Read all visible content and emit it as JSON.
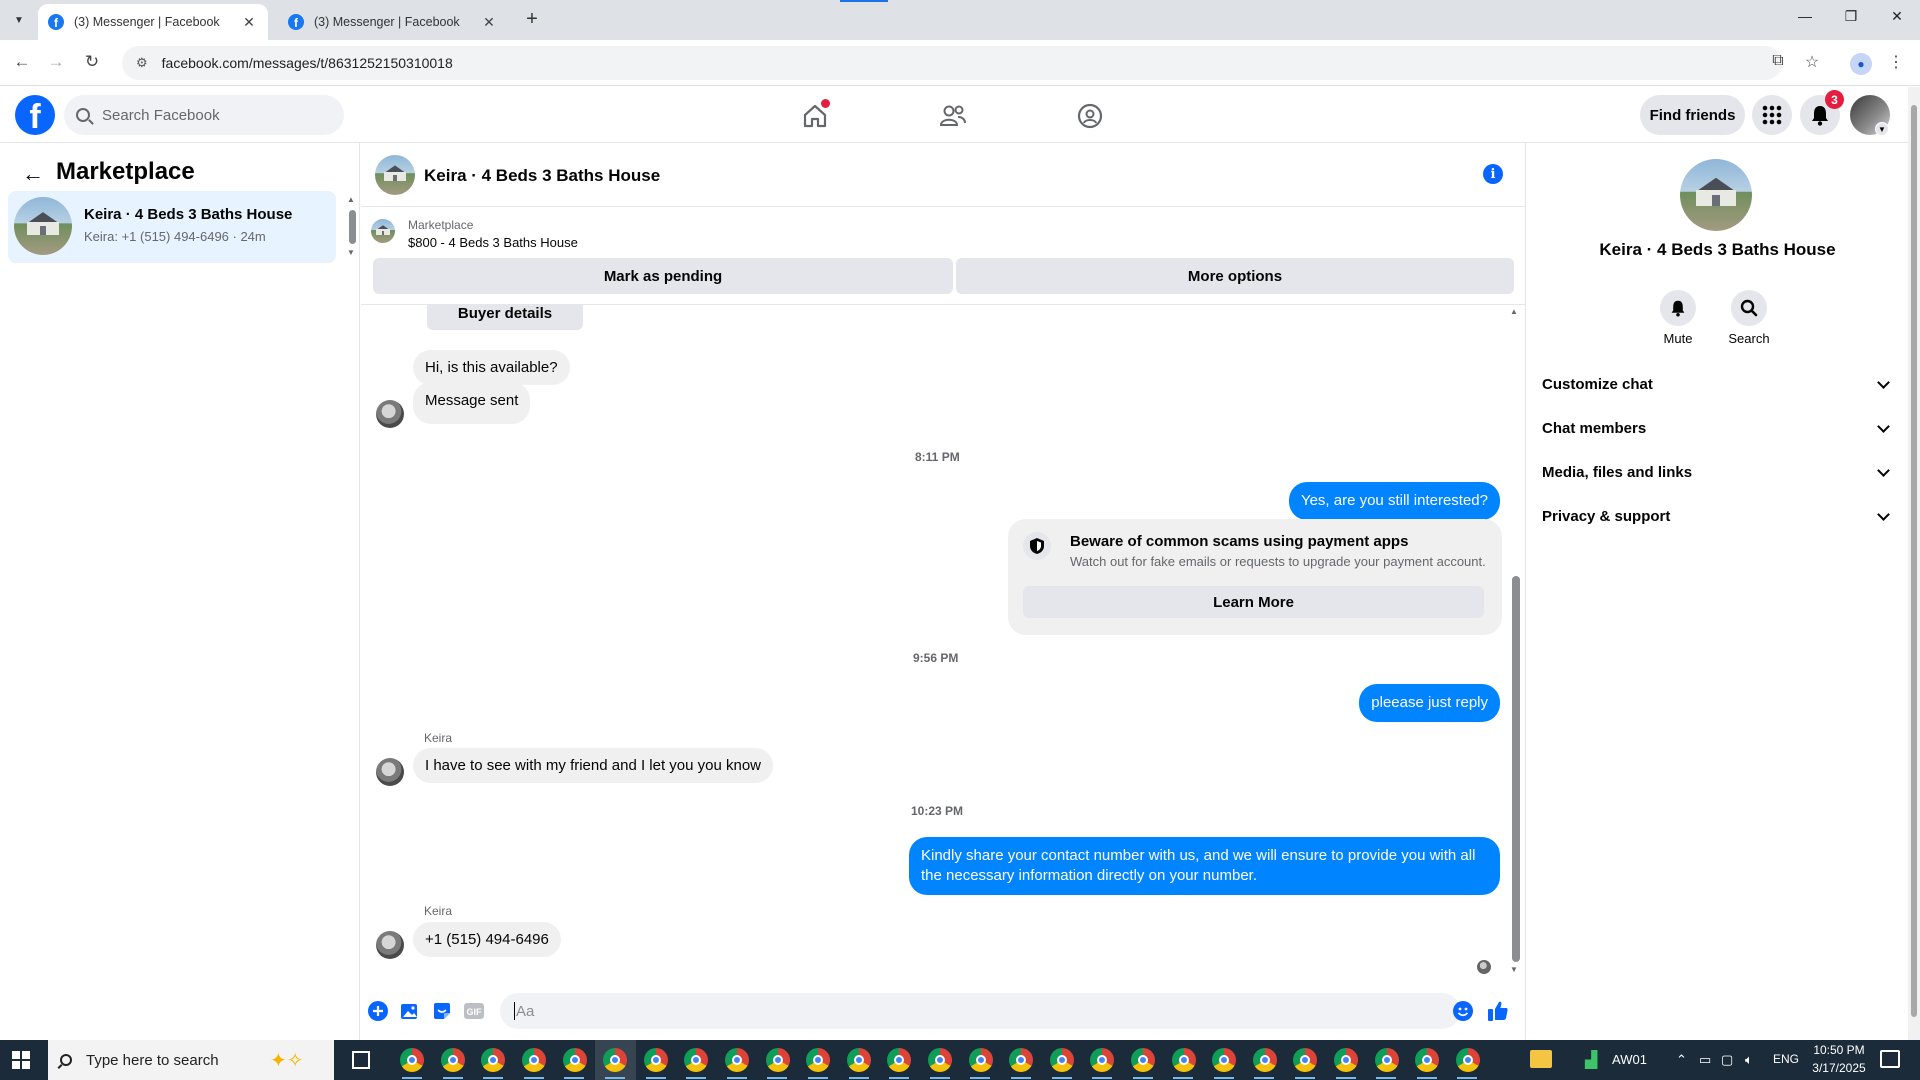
{
  "browser": {
    "tabs": [
      {
        "title": "(3) Messenger | Facebook",
        "active": true
      },
      {
        "title": "(3) Messenger | Facebook",
        "active": false
      }
    ],
    "url": "facebook.com/messages/t/8631252150310018"
  },
  "fb_nav": {
    "search_placeholder": "Search Facebook",
    "find_friends": "Find friends",
    "notifications_count": "3",
    "accent": "#0866ff"
  },
  "left_panel": {
    "title": "Marketplace",
    "thread": {
      "name": "Keira · 4 Beds 3 Baths House",
      "preview": "Keira: +1 (515) 494-6496 · 24m"
    }
  },
  "chat": {
    "title": "Keira · 4 Beds 3 Baths House",
    "marketplace_label": "Marketplace",
    "listing": "$800 - 4 Beds 3 Baths House",
    "mark_pending": "Mark as pending",
    "more_options": "More options",
    "buyer_details": "Buyer details",
    "messages": {
      "m1": "Hi, is this available?",
      "m2": "Message sent",
      "ts1": "8:11 PM",
      "m3": "Yes, are you still interested?",
      "scam_title": "Beware of common scams using payment apps",
      "scam_body": "Watch out for fake emails or requests to upgrade your payment account.",
      "learn_more": "Learn More",
      "ts2": "9:56 PM",
      "m4": "pleease just reply",
      "sender1": "Keira",
      "m5": "I have to see with my friend and I let you you know",
      "ts3": "10:23 PM",
      "m6": "Kindly share your contact number with us, and we will ensure to provide you with all the necessary information directly on your number.",
      "sender2": "Keira",
      "m7": "+1 (515) 494-6496"
    },
    "composer_placeholder": "Aa",
    "outgoing_color": "#0084ff"
  },
  "right_panel": {
    "name": "Keira · 4 Beds 3 Baths House",
    "mute": "Mute",
    "search": "Search",
    "sections": [
      "Customize chat",
      "Chat members",
      "Media, files and links",
      "Privacy & support"
    ]
  },
  "taskbar": {
    "search_placeholder": "Type here to search",
    "stock_label": "AW01",
    "lang": "ENG",
    "time": "10:50 PM",
    "date": "3/17/2025"
  }
}
